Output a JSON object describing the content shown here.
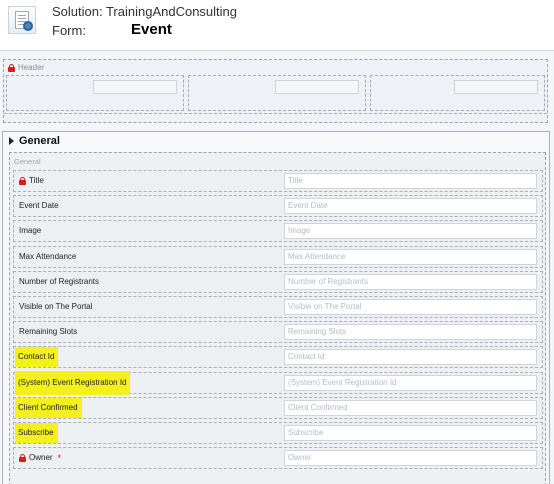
{
  "header": {
    "solution_text": "Solution: TrainingAndConsulting",
    "form_label": "Form:",
    "form_name": "Event"
  },
  "header_section": {
    "title": "Header"
  },
  "tab": {
    "title": "General",
    "section_title": "General",
    "fields": [
      {
        "label": "Title",
        "placeholder": "Title",
        "locked": true,
        "required": false,
        "highlighted": false
      },
      {
        "label": "Event Date",
        "placeholder": "Event Date",
        "locked": false,
        "required": false,
        "highlighted": false
      },
      {
        "label": "Image",
        "placeholder": "Image",
        "locked": false,
        "required": false,
        "highlighted": false
      },
      {
        "label": "Max Attendance",
        "placeholder": "Max Attendance",
        "locked": false,
        "required": false,
        "highlighted": false
      },
      {
        "label": "Number of Registrants",
        "placeholder": "Number of Registrants",
        "locked": false,
        "required": false,
        "highlighted": false
      },
      {
        "label": "Visible on The Portal",
        "placeholder": "Visible on The Portal",
        "locked": false,
        "required": false,
        "highlighted": false
      },
      {
        "label": "Remaining Slots",
        "placeholder": "Remaining Slots",
        "locked": false,
        "required": false,
        "highlighted": false
      },
      {
        "label": "Contact Id",
        "placeholder": "Contact Id",
        "locked": false,
        "required": false,
        "highlighted": true
      },
      {
        "label": "(System) Event Registration Id",
        "placeholder": "(System) Event Registration Id",
        "locked": false,
        "required": false,
        "highlighted": true
      },
      {
        "label": "Client Confirmed",
        "placeholder": "Client Confirmed",
        "locked": false,
        "required": false,
        "highlighted": true
      },
      {
        "label": "Subscribe",
        "placeholder": "Subscribe",
        "locked": false,
        "required": false,
        "highlighted": true
      },
      {
        "label": "Owner",
        "placeholder": "Owner",
        "locked": true,
        "required": true,
        "highlighted": false
      }
    ],
    "required_mark": "*"
  },
  "colors": {
    "highlight": "#f3f01e",
    "lock": "#d21e1e",
    "required": "#c8102e"
  }
}
